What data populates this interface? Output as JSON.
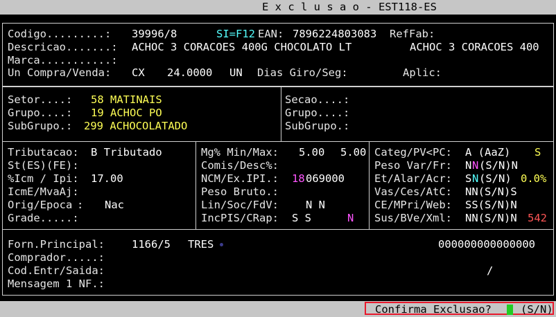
{
  "title": "E x c l u s a o - EST118-ES",
  "header": {
    "codigo_label": "Codigo.........:",
    "codigo_value": "39996/8",
    "f12_hint": "SI=F12",
    "ean_label": "EAN:",
    "ean_value": "7896224803083",
    "reffab_label": "RefFab:",
    "descricao_label": "Descricao.......:",
    "descricao_value": "ACHOC 3 CORACOES 400G CHOCOLATO LT",
    "descricao_short": "ACHOC 3 CORACOES 400",
    "marca_label": "Marca...........:",
    "uncompra_label": "Un Compra/Venda:",
    "un_compra": "CX",
    "fator": "24.0000",
    "un_venda": "UN",
    "diasgiro_label": "Dias Giro/Seg:",
    "aplic_label": "Aplic:"
  },
  "classif": {
    "setor_label": "Setor....:",
    "setor_value": "58 MATINAIS",
    "grupo_label": "Grupo....:",
    "grupo_value": "19 ACHOC PO",
    "subgrupo_label": "SubGrupo.:",
    "subgrupo_value": "299 ACHOCOLATADO",
    "secao_label": "Secao....:",
    "grupo2_label": "Grupo....:",
    "subgrupo2_label": "SubGrupo.:"
  },
  "fiscal": {
    "tributacao_label": "Tributacao:",
    "tributacao_value": "B Tributado",
    "st_label": "St(ES)(FE):",
    "icm_label": "%Icm / Ipi:",
    "icm_value": "17.00",
    "icme_label": "IcmE/MvaAj:",
    "orig_label": "Orig/Epoca",
    "orig_colon": ":",
    "orig_value": "Nac",
    "grade_label": "Grade.....:"
  },
  "pricing": {
    "mg_label": "Mg% Min/Max:",
    "mg_min": "5.00",
    "mg_max": "5.00",
    "comis_label": "Comis/Desc%:",
    "ncm_label": "NCM/Ex.IPI.:",
    "ncm_prefix": "18",
    "ncm_rest": "069000",
    "peso_label": "Peso Bruto.:",
    "lin_label": "Lin/Soc/FdV:",
    "lin_value": "N N",
    "incpis_label": "IncPIS/CRap:",
    "incpis_value": "S S",
    "incpis_flag": "N"
  },
  "flags": {
    "categ_label": "Categ/PV<PC:",
    "categ_value": "A (AaZ)",
    "categ_flag": "S",
    "pesovar_label": "Peso Var/Fr:",
    "pesovar_a": "N",
    "pesovar_b": "N",
    "pesovar_c": "(S/N)N",
    "etalar_label": "Et/Alar/Acr:",
    "etalar_a": "S",
    "etalar_b": "N",
    "etalar_c": "(S/N)",
    "etalar_pct": "0.0%",
    "vas_label": "Vas/Ces/AtC:",
    "vas_value": "NN(S/N)S",
    "ce_label": "CE/MPri/Web:",
    "ce_value": "SS(S/N)N",
    "sus_label": "Sus/BVe/Xml:",
    "sus_value": "NN(S/N)N",
    "sus_code": "542"
  },
  "supplier": {
    "forn_label": "Forn.Principal:",
    "forn_code": "1166/5",
    "forn_name": "TRES",
    "forn_number": "000000000000000",
    "comprador_label": "Comprador.....:",
    "codentr_label": "Cod.Entr/Saida:",
    "codentr_sep": "/",
    "mensagem_label": "Mensagem 1 NF.:"
  },
  "status": {
    "confirm_label": "Confirma Exclusao?",
    "confirm_options": "(S/N)"
  }
}
